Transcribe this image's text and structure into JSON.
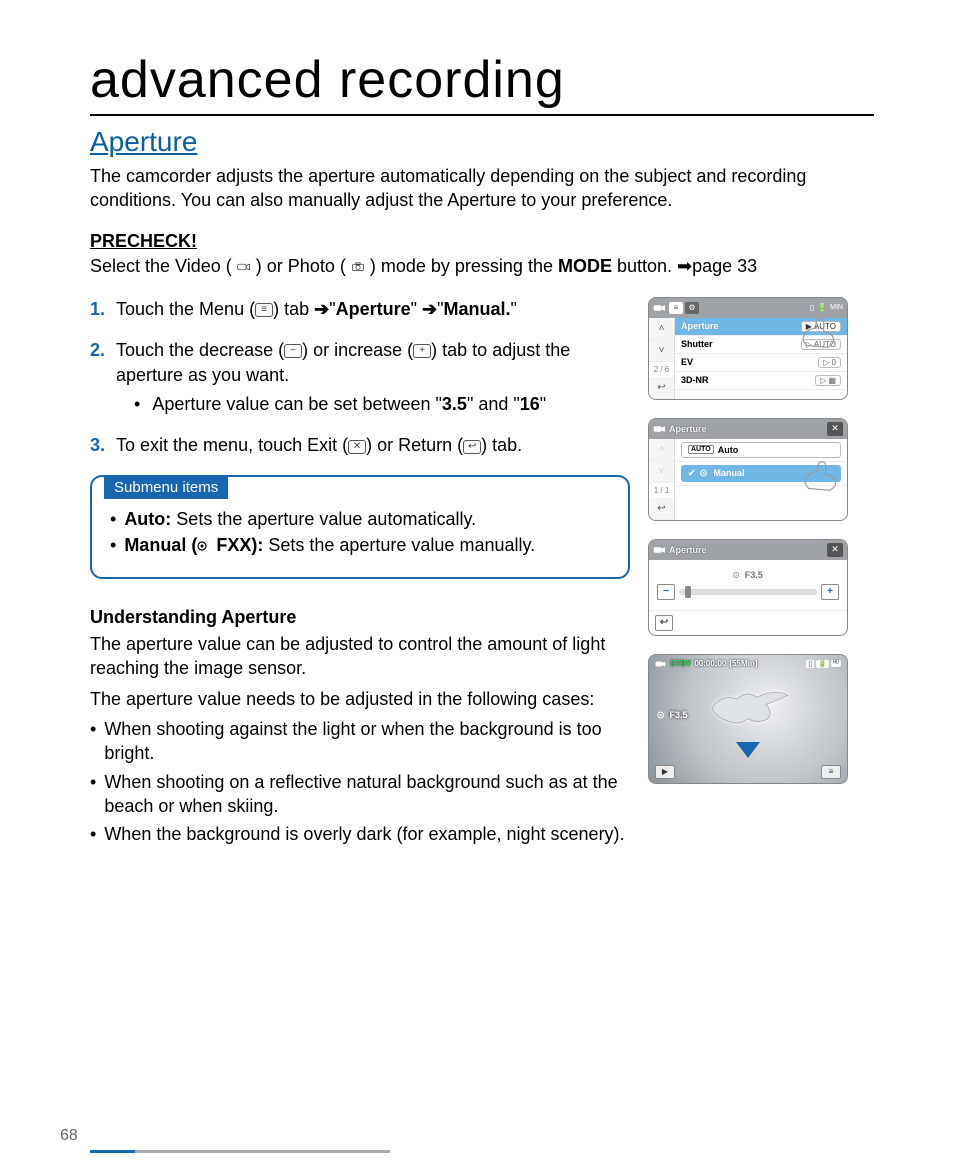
{
  "chapter_title": "advanced recording",
  "section_title": "Aperture",
  "intro": "The camcorder adjusts the aperture automatically depending on the subject and recording conditions. You can also manually adjust the Aperture to your preference.",
  "precheck": {
    "label": "PRECHECK!",
    "before_video": "Select the Video (",
    "between": ") or Photo (",
    "after_photo": ") mode by pressing the ",
    "mode_btn": "MODE",
    "tail": " button. ➡page 33"
  },
  "steps": {
    "one_a": "Touch the Menu (",
    "one_b": ") tab ",
    "one_c": "\"",
    "one_ap": "Aperture",
    "one_d": "\" ",
    "one_e": "\"",
    "one_man": "Manual.",
    "one_f": "\"",
    "two_a": "Touch the decrease (",
    "two_b": ") or increase (",
    "two_c": ") tab to adjust the aperture as you want.",
    "two_bullet_a": "Aperture value can be set between \"",
    "two_bullet_v1": "3.5",
    "two_bullet_b": "\" and \"",
    "two_bullet_v2": "16",
    "two_bullet_c": "\"",
    "three_a": "To exit the menu, touch Exit (",
    "three_b": ") or Return (",
    "three_c": ") tab."
  },
  "nums": {
    "n1": "1.",
    "n2": "2.",
    "n3": "3."
  },
  "submenu": {
    "tag": "Submenu items",
    "auto_label": "Auto:",
    "auto_text": " Sets the aperture value automatically.",
    "manual_label": "Manual (",
    "manual_mid": " FXX):",
    "manual_text": " Sets the aperture value manually."
  },
  "understanding": {
    "heading": "Understanding Aperture",
    "p1": "The aperture value can be adjusted to control the amount of light reaching the image sensor.",
    "p2": "The aperture value needs to be adjusted in the following cases:",
    "cases": [
      "When shooting against the light or when the background is too bright.",
      "When shooting on a reflective natural background such as at the beach or when skiing.",
      "When the background is overly dark (for example, night scenery)."
    ]
  },
  "rc": {
    "card1": {
      "rows": [
        {
          "label": "Aperture",
          "val": "AUTO",
          "highlight": true
        },
        {
          "label": "Shutter",
          "val": "AUTO"
        },
        {
          "label": "EV",
          "val": "0"
        },
        {
          "label": "3D-NR",
          "val": ""
        }
      ],
      "pag": "2 / 6"
    },
    "card2": {
      "title": "Aperture",
      "options": [
        {
          "label": "Auto"
        },
        {
          "label": "Manual",
          "highlight": true,
          "check": true
        }
      ],
      "pag": "1 / 1"
    },
    "card3": {
      "title": "Aperture",
      "val_label": "F3.5"
    },
    "card4": {
      "stby": "STBY",
      "timecode": "00:00:00",
      "remain": "[55Min]",
      "fval": "F3.5"
    }
  },
  "page_number": "68"
}
